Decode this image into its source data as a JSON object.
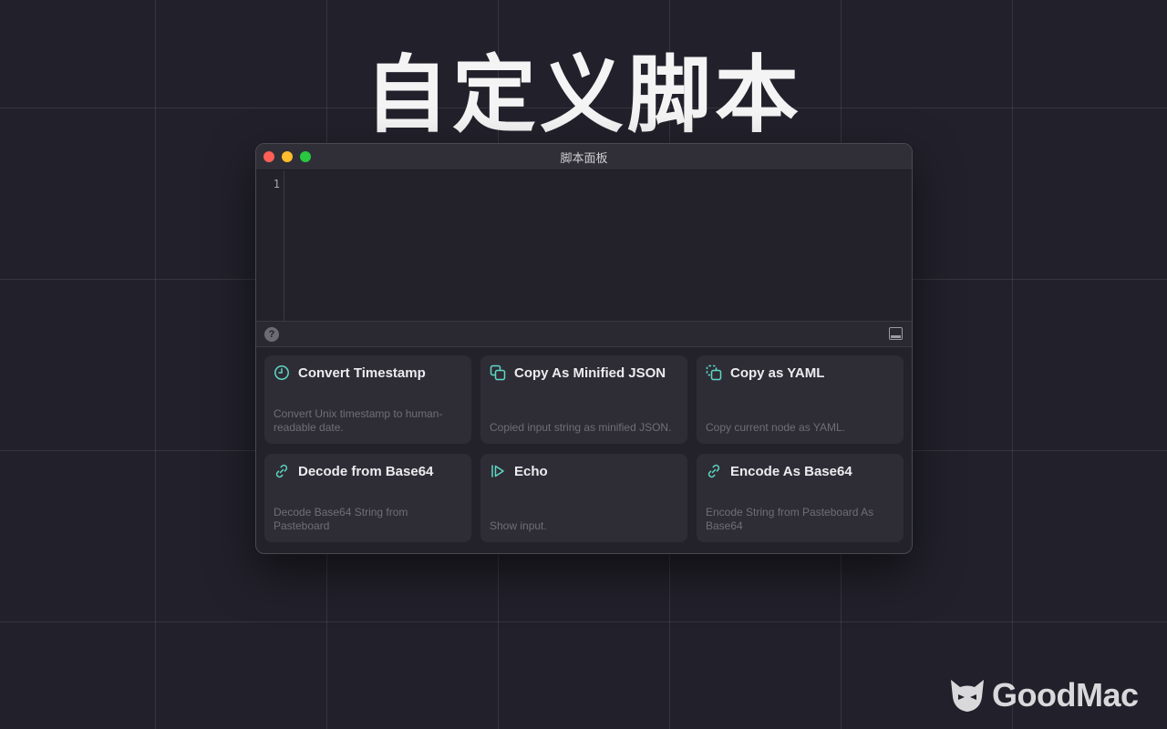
{
  "headline": "自定义脚本",
  "window": {
    "title": "脚本面板",
    "line_number": "1",
    "help_label": "?"
  },
  "scripts": [
    {
      "icon": "clock-icon",
      "title": "Convert Timestamp",
      "description": "Convert Unix timestamp to human-readable date."
    },
    {
      "icon": "copy-icon",
      "title": "Copy As Minified JSON",
      "description": "Copied input string as minified JSON."
    },
    {
      "icon": "copy-dashed-icon",
      "title": "Copy as YAML",
      "description": "Copy current node as YAML."
    },
    {
      "icon": "link-icon",
      "title": "Decode from Base64",
      "description": "Decode Base64 String from Pasteboard"
    },
    {
      "icon": "play-icon",
      "title": "Echo",
      "description": "Show input."
    },
    {
      "icon": "link-icon",
      "title": "Encode As Base64",
      "description": "Encode String from Pasteboard As Base64"
    }
  ],
  "brand": {
    "name": "GoodMac"
  },
  "colors": {
    "accent": "#5fd8c4",
    "background": "#22212b"
  }
}
